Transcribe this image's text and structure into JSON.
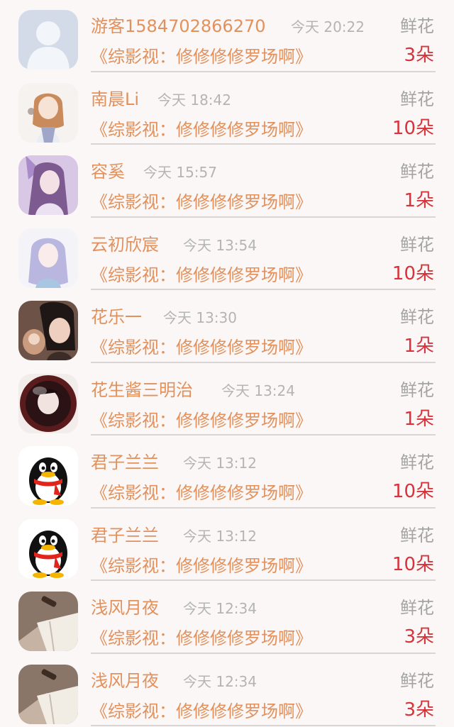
{
  "gift_label": "鲜花",
  "colors": {
    "accent_orange": "#e2915c",
    "count_red": "#d8323a",
    "time_gray": "#b4b4b4",
    "gift_gray": "#a4a4a4",
    "background": "#fbf7f7"
  },
  "rows": [
    {
      "name": "游客1584702866270",
      "time": "今天 20:22",
      "book": "《综影视：修修修修罗场啊》",
      "count": "3朵",
      "avatar": "default-user-avatar"
    },
    {
      "name": "南晨Li",
      "time": "今天 18:42",
      "book": "《综影视：修修修修罗场啊》",
      "count": "10朵",
      "avatar": "anime-girl-avatar"
    },
    {
      "name": "容奚",
      "time": "今天 15:57",
      "book": "《综影视：修修修修罗场啊》",
      "count": "1朵",
      "avatar": "purple-girl-avatar"
    },
    {
      "name": "云初欣宸",
      "time": "今天 13:54",
      "book": "《综影视：修修修修罗场啊》",
      "count": "10朵",
      "avatar": "lavender-girl-avatar"
    },
    {
      "name": "花乐一",
      "time": "今天 13:30",
      "book": "《综影视：修修修修罗场啊》",
      "count": "1朵",
      "avatar": "photo-girl-avatar"
    },
    {
      "name": "花生酱三明治",
      "time": "今天 13:24",
      "book": "《综影视：修修修修罗场啊》",
      "count": "1朵",
      "avatar": "sphere-art-avatar"
    },
    {
      "name": "君子兰兰",
      "time": "今天 13:12",
      "book": "《综影视：修修修修罗场啊》",
      "count": "10朵",
      "avatar": "qq-penguin-avatar"
    },
    {
      "name": "君子兰兰",
      "time": "今天 13:12",
      "book": "《综影视：修修修修罗场啊》",
      "count": "10朵",
      "avatar": "qq-penguin-avatar"
    },
    {
      "name": "浅风月夜",
      "time": "今天 12:34",
      "book": "《综影视：修修修修罗场啊》",
      "count": "3朵",
      "avatar": "open-book-avatar"
    },
    {
      "name": "浅风月夜",
      "time": "今天 12:34",
      "book": "《综影视：修修修修罗场啊》",
      "count": "3朵",
      "avatar": "open-book-avatar"
    }
  ]
}
